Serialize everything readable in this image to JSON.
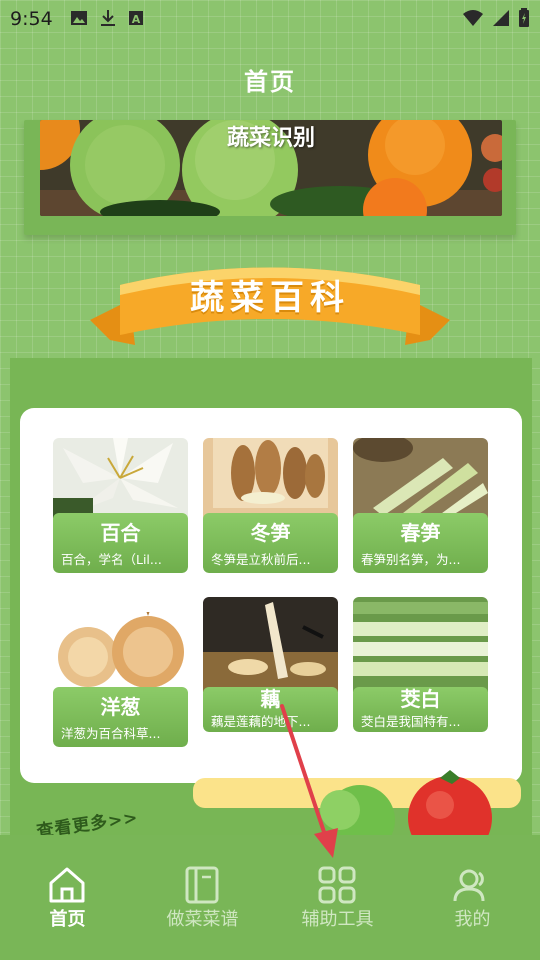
{
  "status": {
    "time": "9:54",
    "left_icons": [
      "image-icon",
      "download-icon",
      "a-box-icon"
    ],
    "right_icons": [
      "wifi-icon",
      "signal-icon",
      "battery-icon"
    ]
  },
  "header": {
    "title": "首页"
  },
  "banner": {
    "title": "蔬菜识别"
  },
  "section": {
    "title": "蔬菜百科"
  },
  "cards": [
    {
      "name": "百合",
      "desc": "百合，学名（Lil..."
    },
    {
      "name": "冬笋",
      "desc": "冬笋是立秋前后..."
    },
    {
      "name": "春笋",
      "desc": "春笋别名笋，为..."
    },
    {
      "name": "洋葱",
      "desc": "洋葱为百合科草..."
    },
    {
      "name": "藕",
      "desc": "藕是莲藕的地下..."
    },
    {
      "name": "茭白",
      "desc": "茭白是我国特有..."
    }
  ],
  "more": {
    "label": "查看更多>>"
  },
  "nav": {
    "items": [
      {
        "label": "首页",
        "icon": "home-icon",
        "active": true
      },
      {
        "label": "做菜菜谱",
        "icon": "recipe-book-icon",
        "active": false
      },
      {
        "label": "辅助工具",
        "icon": "grid-tools-icon",
        "active": false
      },
      {
        "label": "我的",
        "icon": "profile-icon",
        "active": false
      }
    ]
  },
  "colors": {
    "background": "#8cc46e",
    "nav_bar": "#79b657",
    "card_green": "#78b655",
    "ribbon": "#f7a928",
    "arrow": "#e0404a"
  }
}
